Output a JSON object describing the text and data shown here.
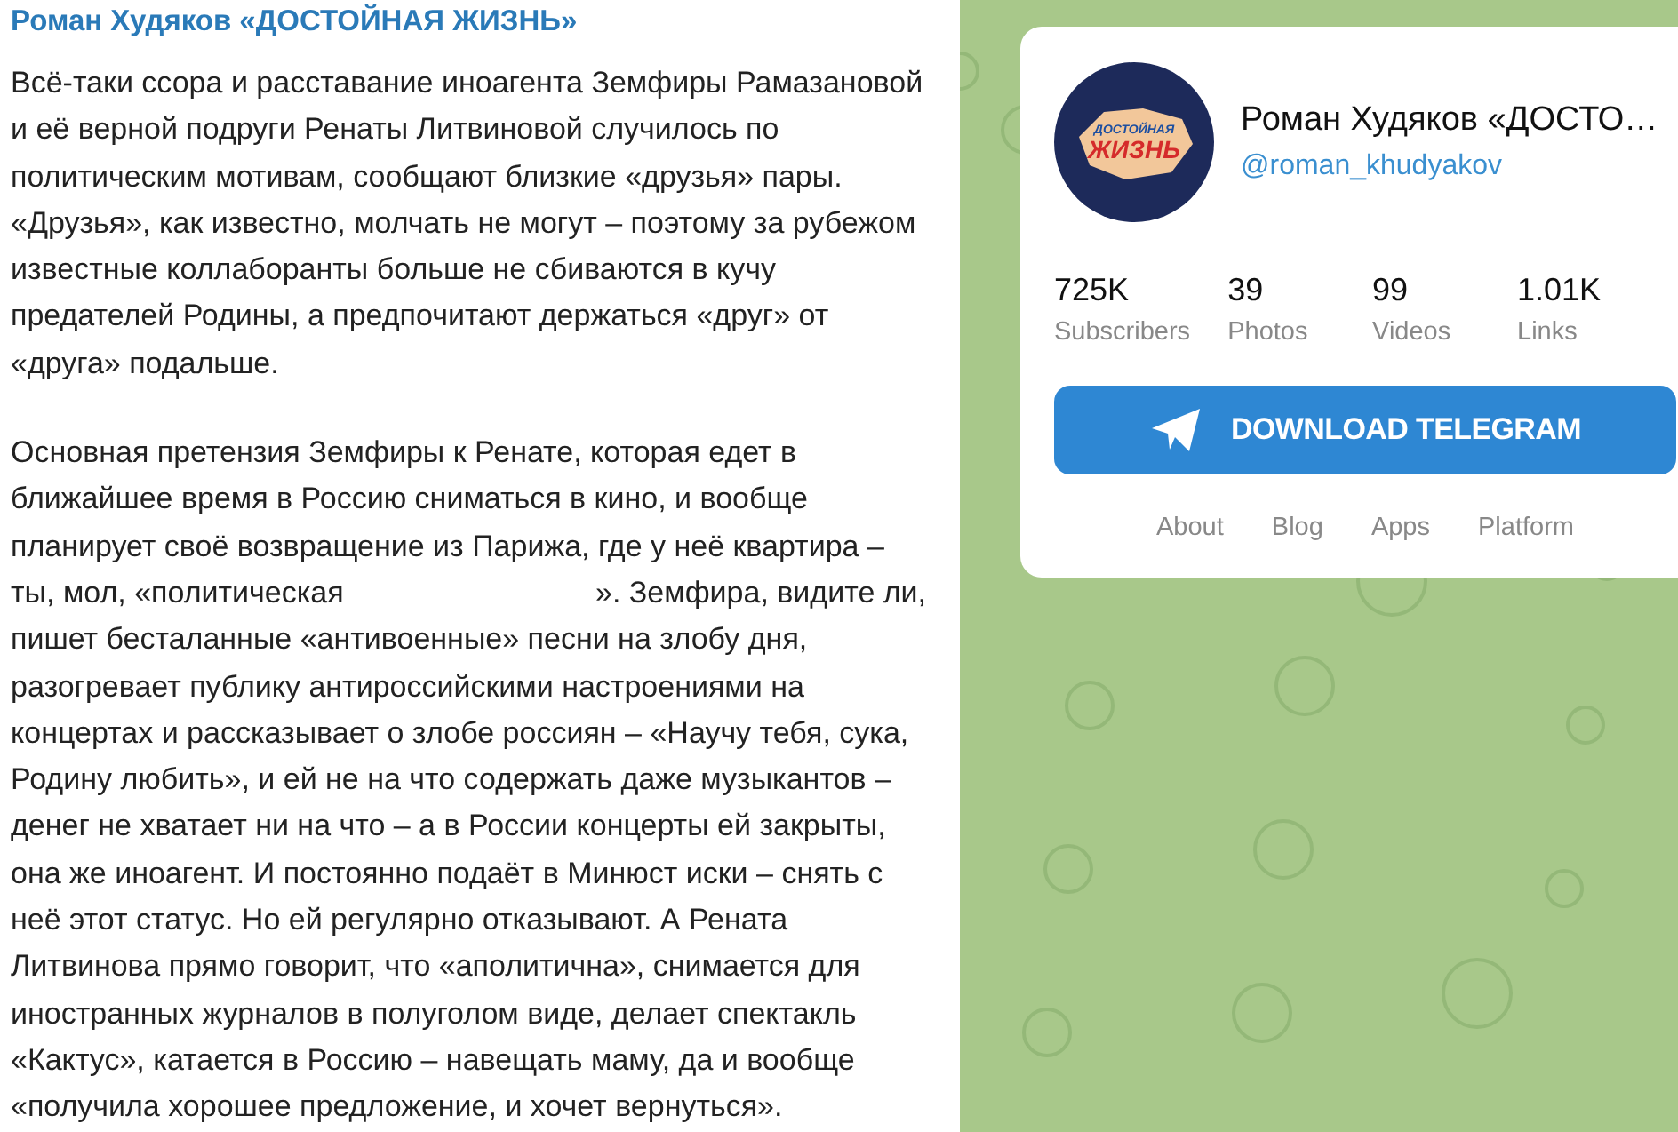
{
  "post": {
    "channel_title": "Роман Худяков «ДОСТОЙНАЯ ЖИЗНЬ»",
    "paragraphs": [
      "Всё-таки ссора и расставание иноагента Земфиры Рамазановой и её верной подруги Ренаты Литвиновой случилось по политическим мотивам, сообщают близкие «друзья» пары. «Друзья», как известно, молчать не могут – поэтому за рубежом известные коллаборанты больше не сбиваются в кучу предателей Родины, а предпочитают держаться «друг» от «друга» подальше.",
      "Основная претензия Земфиры к Ренате, которая едет в ближайшее время в Россию сниматься в кино, и вообще планирует своё возвращение из Парижа, где у неё квартира – ты, мол, «политическая                              ». Земфира, видите ли, пишет бесталанные «антивоенные» песни на злобу дня, разогревает публику антироссийскими настроениями на концертах и рассказывает о злобе россиян – «Научу тебя, сука, Родину любить», и ей не на что содержать даже музыкантов – денег не хватает ни на что – а в России концерты ей закрыты, она же иноагент. И постоянно подаёт в Минюст иски – снять с неё этот статус. Но ей регулярно отказывают. А Рената Литвинова прямо говорит, что «аполитична», снимается для иностранных журналов в полуголом виде, делает спектакль «Кактус», катается в Россию – навещать маму, да и вообще «получила хорошее предложение, и хочет вернуться»."
    ]
  },
  "channel_card": {
    "avatar": {
      "logo_line_1": "ДОСТОЙНАЯ",
      "logo_line_2": "ЖИЗНЬ"
    },
    "name": "Роман Худяков «ДОСТО…",
    "username": "@roman_khudyakov",
    "stats": [
      {
        "value": "725K",
        "label": "Subscribers"
      },
      {
        "value": "39",
        "label": "Photos"
      },
      {
        "value": "99",
        "label": "Videos"
      },
      {
        "value": "1.01K",
        "label": "Links"
      }
    ],
    "download_button": "DOWNLOAD TELEGRAM",
    "footer_links": [
      "About",
      "Blog",
      "Apps",
      "Platform"
    ]
  }
}
